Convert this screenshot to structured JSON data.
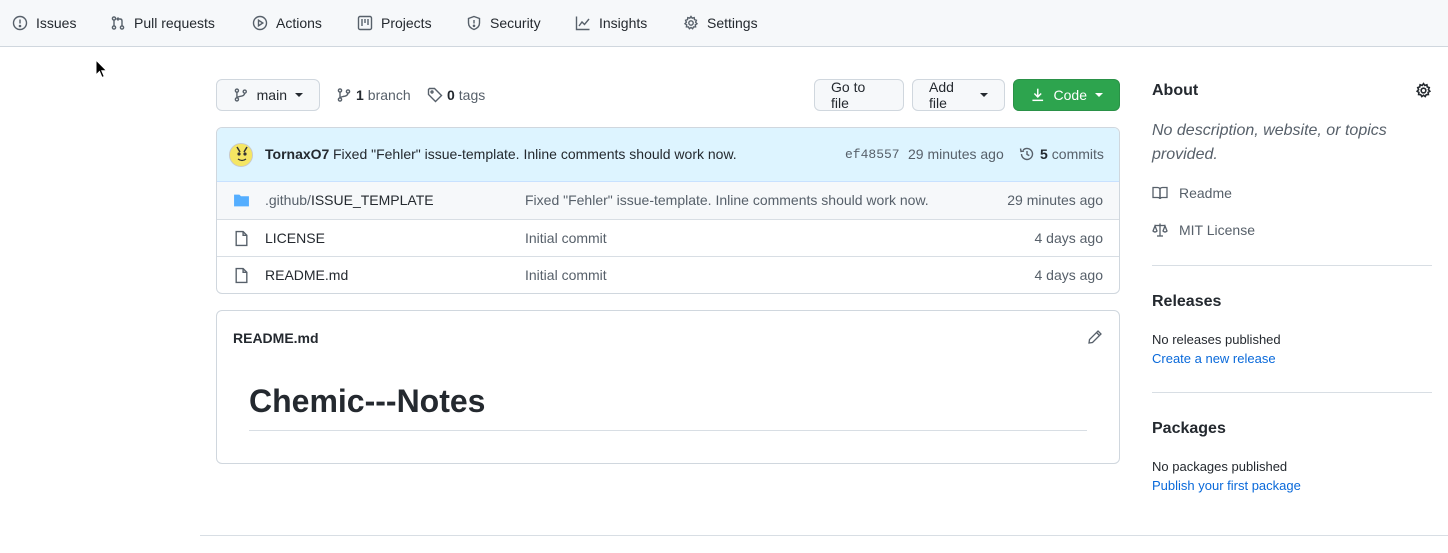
{
  "nav": {
    "tabs": [
      {
        "label": "Issues",
        "icon": "issue-icon"
      },
      {
        "label": "Pull requests",
        "icon": "pull-request-icon"
      },
      {
        "label": "Actions",
        "icon": "play-icon"
      },
      {
        "label": "Projects",
        "icon": "project-icon"
      },
      {
        "label": "Security",
        "icon": "shield-icon"
      },
      {
        "label": "Insights",
        "icon": "graph-icon"
      },
      {
        "label": "Settings",
        "icon": "gear-icon"
      }
    ]
  },
  "toolbar": {
    "branch_name": "main",
    "branch_count": "1",
    "branch_label": "branch",
    "tag_count": "0",
    "tag_label": "tags",
    "go_to_file": "Go to file",
    "add_file": "Add file",
    "code": "Code"
  },
  "commit": {
    "author": "TornaxO7",
    "message": "Fixed \"Fehler\" issue-template. Inline comments should work now.",
    "sha": "ef48557",
    "time": "29 minutes ago",
    "count": "5",
    "count_label": "commits"
  },
  "files": [
    {
      "type": "folder",
      "dim_prefix": ".github/",
      "name": "ISSUE_TEMPLATE",
      "message": "Fixed \"Fehler\" issue-template. Inline comments should work now.",
      "age": "29 minutes ago"
    },
    {
      "type": "file",
      "dim_prefix": "",
      "name": "LICENSE",
      "message": "Initial commit",
      "age": "4 days ago"
    },
    {
      "type": "file",
      "dim_prefix": "",
      "name": "README.md",
      "message": "Initial commit",
      "age": "4 days ago"
    }
  ],
  "readme": {
    "title": "README.md",
    "heading": "Chemic---Notes"
  },
  "sidebar": {
    "about_title": "About",
    "about_description": "No description, website, or topics provided.",
    "readme_link": "Readme",
    "license_link": "MIT License",
    "releases_title": "Releases",
    "releases_note": "No releases published",
    "releases_link": "Create a new release",
    "packages_title": "Packages",
    "packages_note": "No packages published",
    "packages_link": "Publish your first package"
  },
  "colors": {
    "accent_blue": "#0969da",
    "button_green": "#2da44e",
    "commit_bar_bg": "#ddf4ff",
    "folder_blue": "#54aeff"
  }
}
